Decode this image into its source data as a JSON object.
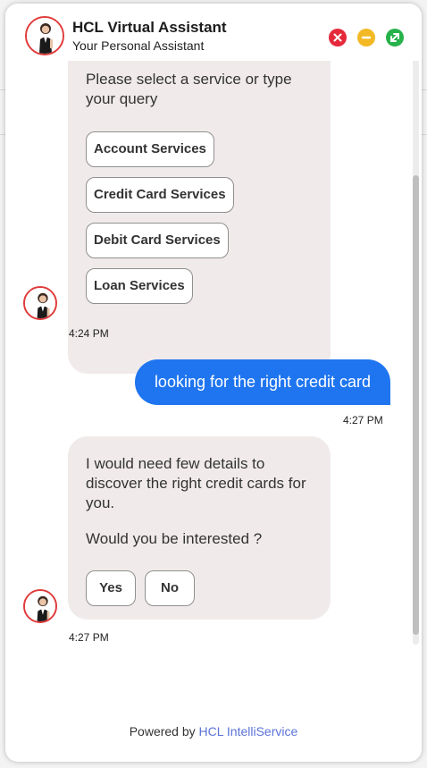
{
  "header": {
    "title": "HCL Virtual Assistant",
    "subtitle": "Your Personal Assistant",
    "controls": [
      {
        "name": "close",
        "icon": "close-icon",
        "color": "#e5293b"
      },
      {
        "name": "minimize",
        "icon": "minus-icon",
        "color": "#f3b925"
      },
      {
        "name": "maximize",
        "icon": "expand-icon",
        "color": "#27b24a"
      }
    ]
  },
  "messages": [
    {
      "sender": "bot",
      "text": "Please select a service or type your query",
      "options": [
        "Account Services",
        "Credit Card Services",
        "Debit Card Services",
        "Loan Services"
      ],
      "time": "4:24 PM"
    },
    {
      "sender": "user",
      "text": "looking for the right credit card",
      "time": "4:27 PM"
    },
    {
      "sender": "bot",
      "text": "I would need few details to discover the right credit cards for you.",
      "text2": "Would you be interested ?",
      "options": [
        "Yes",
        "No"
      ],
      "time": "4:27 PM"
    }
  ],
  "footer": {
    "prefix": "Powered by",
    "link": "HCL IntelliService"
  },
  "colors": {
    "accent": "#1f75f0",
    "bot_bubble": "#f0ebea",
    "avatar_ring": "#e03a3a",
    "footer_link": "#5b73d8"
  }
}
